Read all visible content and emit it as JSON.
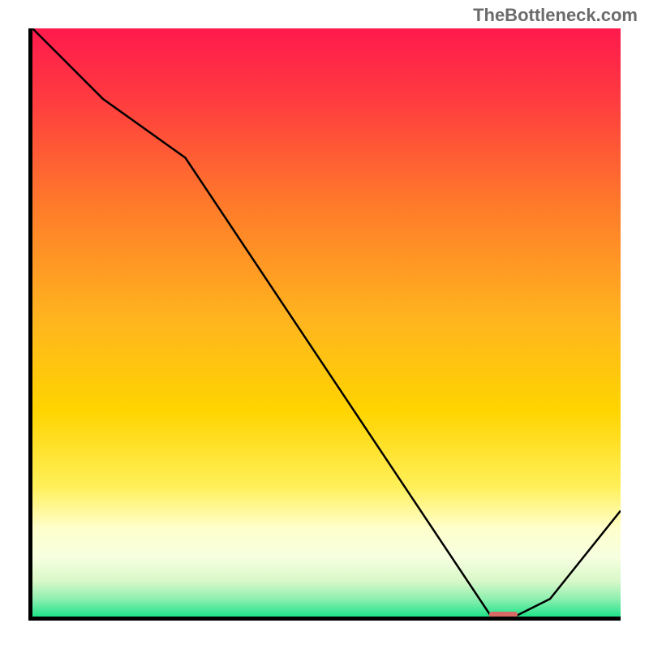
{
  "watermark": "TheBottleneck.com",
  "chart_data": {
    "type": "line",
    "x": [
      0,
      5,
      12,
      26,
      78,
      82,
      88,
      100
    ],
    "values": [
      100,
      95,
      88,
      78,
      0,
      0,
      3,
      18
    ],
    "title": "",
    "xlabel": "",
    "ylabel": "",
    "xlim": [
      0,
      100
    ],
    "ylim": [
      0,
      100
    ],
    "flat_segment": {
      "x0": 78,
      "x1": 82,
      "y": 0
    }
  },
  "colors": {
    "top": "#ff1a4d",
    "mid": "#ffd400",
    "pale": "#ffffcc",
    "bottom": "#21e38a",
    "marker": "#d86a66"
  }
}
